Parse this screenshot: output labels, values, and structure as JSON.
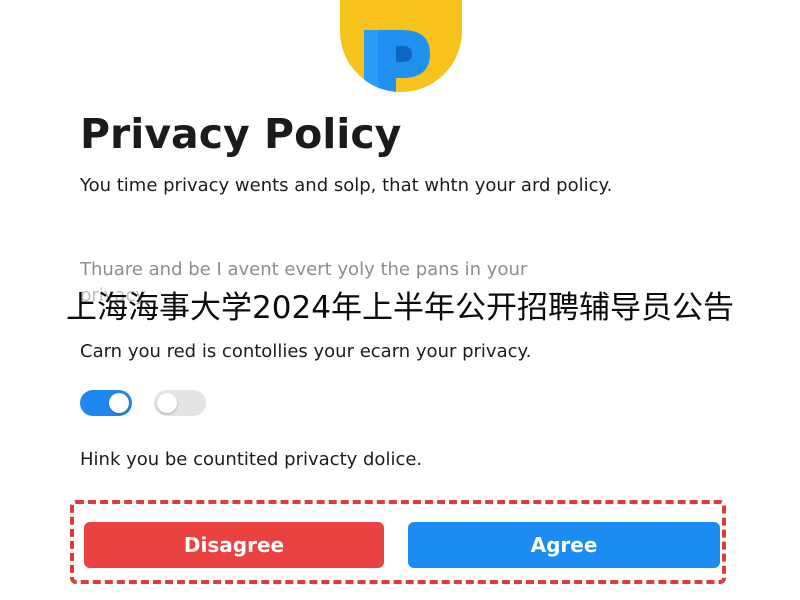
{
  "header": {
    "logo_icon": "p-logo-icon",
    "title": "Privacy Policy"
  },
  "content": {
    "paragraph_1": "You time privacy wents and solp, that whtn your ard policy.",
    "paragraph_2_line_1": "Thuare and be I avent evert yoly the pans in your",
    "paragraph_2_line_2": "privacy",
    "paragraph_3": "Carn you red is contollies your ecarn your privacy.",
    "paragraph_4": "Hink you be countited privacty dolice."
  },
  "toggles": [
    {
      "state": "on"
    },
    {
      "state": "off"
    }
  ],
  "buttons": {
    "disagree_label": "Disagree",
    "agree_label": "Agree"
  },
  "overlay": {
    "banner_text": "上海海事大学2024年上半年公开招聘辅导员公告"
  },
  "colors": {
    "logo_yellow": "#f6c21b",
    "logo_blue": "#1a88e8",
    "toggle_on": "#1e88f0",
    "toggle_off": "#e4e4e4",
    "disagree": "#ea4141",
    "agree": "#1c8bf2",
    "highlight_dashed": "#e03b3b"
  }
}
